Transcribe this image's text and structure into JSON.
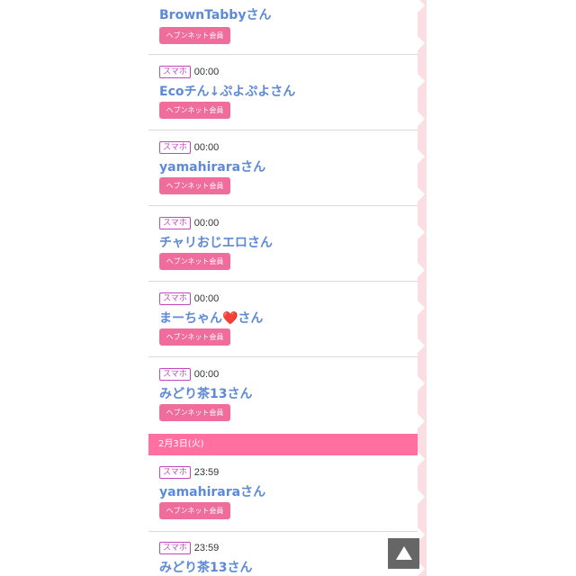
{
  "entries_top": [
    {
      "device": "",
      "time": "",
      "name": "BrownTabbyさん",
      "badge": "ヘブンネット会員"
    },
    {
      "device": "スマホ",
      "time": "00:00",
      "name": "Ecoチん↓ぷよぷよさん",
      "badge": "ヘブンネット会員"
    },
    {
      "device": "スマホ",
      "time": "00:00",
      "name": "yamahiraraさん",
      "badge": "ヘブンネット会員"
    },
    {
      "device": "スマホ",
      "time": "00:00",
      "name": "チャリおじエロさん",
      "badge": "ヘブンネット会員"
    },
    {
      "device": "スマホ",
      "time": "00:00",
      "name": "まーちゃん❤️さん",
      "badge": "ヘブンネット会員"
    },
    {
      "device": "スマホ",
      "time": "00:00",
      "name": "みどり茶13さん",
      "badge": "ヘブンネット会員"
    }
  ],
  "date_header": "2月3日(火)",
  "entries_bottom": [
    {
      "device": "スマホ",
      "time": "23:59",
      "name": "yamahiraraさん",
      "badge": "ヘブンネット会員"
    },
    {
      "device": "スマホ",
      "time": "23:59",
      "name": "みどり茶13さん",
      "badge": ""
    }
  ],
  "colors": {
    "name": "#5d8ad6",
    "badge": "#ef6c9b",
    "device": "#c545c0",
    "date_bar": "#ff6fa0",
    "edge": "#fbdde4"
  },
  "scroll_top_icon": "up-triangle-icon"
}
